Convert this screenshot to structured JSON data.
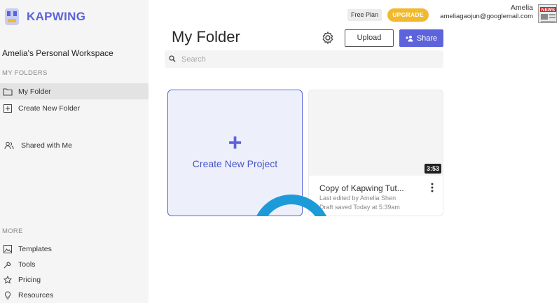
{
  "brand": {
    "name": "KAPWING",
    "accent": "#5c63db"
  },
  "sidebar": {
    "workspace": "Amelia's Personal Workspace",
    "folders_label": "MY FOLDERS",
    "items": [
      {
        "label": "My Folder",
        "icon": "folder-icon"
      },
      {
        "label": "Create New Folder",
        "icon": "plus-square-icon"
      },
      {
        "label": "Shared with Me",
        "icon": "users-icon"
      }
    ],
    "more_label": "MORE",
    "more_items": [
      {
        "label": "Templates",
        "icon": "image-icon"
      },
      {
        "label": "Tools",
        "icon": "wrench-icon"
      },
      {
        "label": "Pricing",
        "icon": "star-icon"
      },
      {
        "label": "Resources",
        "icon": "lightbulb-icon"
      }
    ]
  },
  "topbar": {
    "plan": "Free Plan",
    "upgrade": "UPGRADE",
    "user_name": "Amelia",
    "user_email": "ameliagaojun@googlemail.com",
    "avatar_text": "NEWS"
  },
  "header": {
    "title": "My Folder",
    "upload": "Upload",
    "share": "Share",
    "search_placeholder": "Search"
  },
  "cards": {
    "create_label": "Create New Project",
    "project": {
      "title": "Copy of Kapwing Tut...",
      "edited": "Last edited by Amelia Shen",
      "saved": "Draft saved Today at 5:39am",
      "duration": "3:53"
    }
  }
}
